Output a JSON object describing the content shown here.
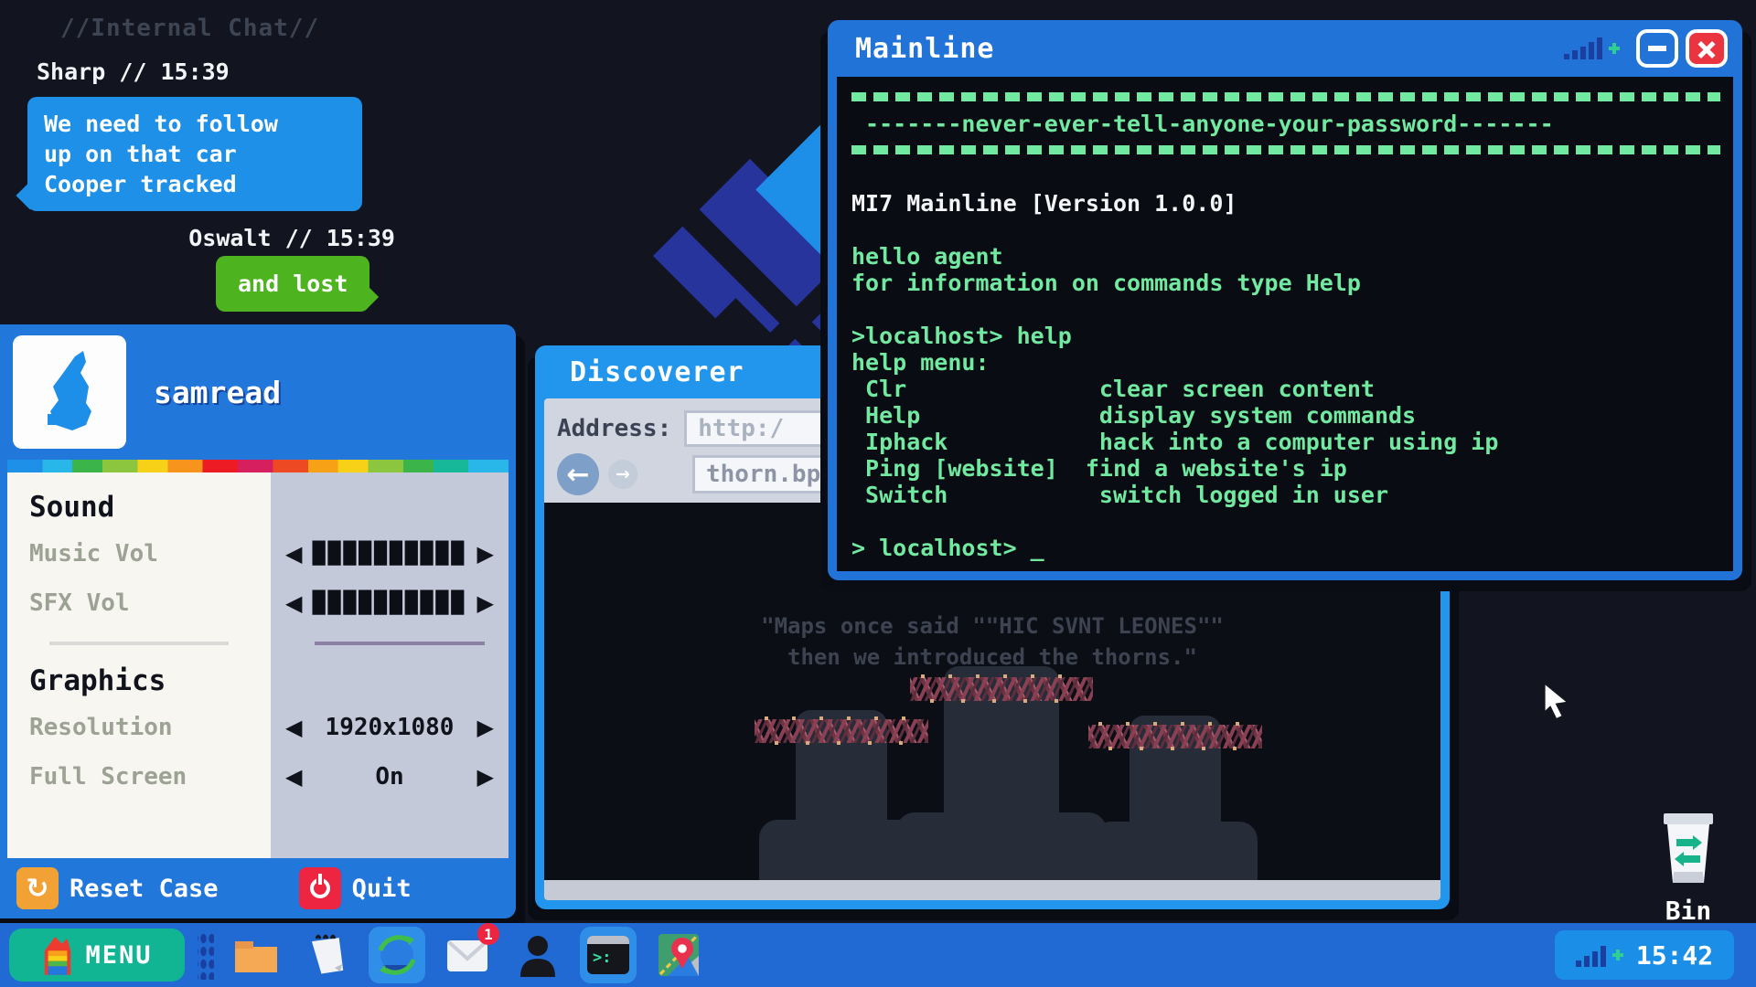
{
  "chat": {
    "title": "//Internal Chat//",
    "message1": {
      "meta": "Sharp // 15:39",
      "line1": "We need to follow",
      "line2": "up on that car",
      "line3": "Cooper tracked"
    },
    "message2": {
      "meta": "Oswalt // 15:39",
      "text": "and lost"
    }
  },
  "settings": {
    "username": "samread",
    "sound_heading": "Sound",
    "music_label": "Music Vol",
    "sfx_label": "SFX Vol",
    "volume_blocks": "██████████",
    "graphics_heading": "Graphics",
    "resolution_label": "Resolution",
    "resolution_value": "1920x1080",
    "fullscreen_label": "Full Screen",
    "fullscreen_value": "On",
    "stepper_left": "◀",
    "stepper_right": "▶",
    "reset_label": "Reset Case",
    "quit_label": "Quit"
  },
  "discoverer": {
    "title": "Discoverer",
    "address_label": "Address:",
    "address_placeholder": "http:/",
    "url_value": "thorn.bp",
    "quote_line1": "\"Maps once said \"\"HIC SVNT LEONES\"\"",
    "quote_line2": "then we introduced the thorns.\""
  },
  "mainline": {
    "title": "Mainline",
    "lines": [
      " -------never-ever-tell-anyone-your-password-------",
      "MI7 Mainline [Version 1.0.0]",
      "hello agent",
      "for information on commands type Help",
      ">localhost> help",
      "help menu:",
      " Clr              clear screen content",
      " Help             display system commands",
      " Iphack           hack into a computer using ip",
      " Ping [website]  find a website's ip",
      " Switch           switch logged in user",
      "> localhost> _"
    ]
  },
  "taskbar": {
    "menu_label": "MENU",
    "mail_badge": "1",
    "terminal_icon_prompt": ">:",
    "clock": "15:42"
  },
  "desktop": {
    "bin_label": "Bin"
  },
  "colors": {
    "window_blue": "#2173d8",
    "browser_blue": "#2196ec",
    "terminal_green": "#72e9a1",
    "chat_blue": "#1e90e8",
    "chat_green": "#4db31e",
    "menu_teal": "#12b593",
    "close_red": "#ea3440",
    "reset_orange": "#f2a235",
    "quit_red": "#ee2540"
  }
}
